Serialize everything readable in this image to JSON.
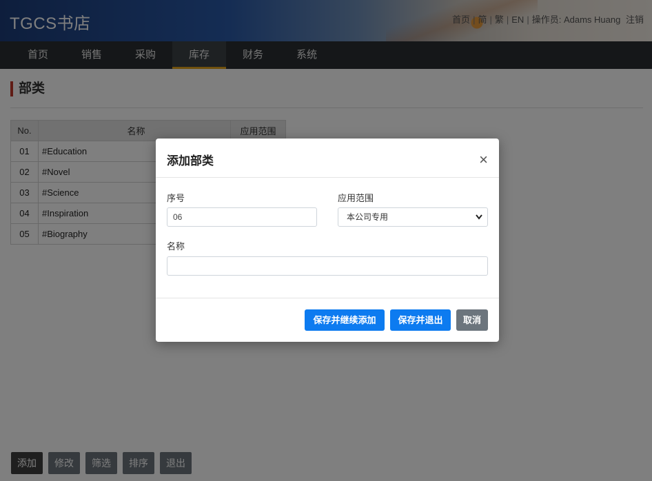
{
  "header": {
    "brand": "TGCS书店",
    "links": [
      "首页",
      "简",
      "繁",
      "EN"
    ],
    "operator_label": "操作员:",
    "operator_name": "Adams Huang",
    "logout": "注销"
  },
  "nav": {
    "items": [
      "首页",
      "销售",
      "采购",
      "库存",
      "财务",
      "系统"
    ],
    "active": "库存"
  },
  "page": {
    "title": "部类"
  },
  "table": {
    "headers": [
      "No.",
      "名称",
      "应用范围"
    ],
    "rows": [
      {
        "no": "01",
        "name": "#Education"
      },
      {
        "no": "02",
        "name": "#Novel"
      },
      {
        "no": "03",
        "name": "#Science"
      },
      {
        "no": "04",
        "name": "#Inspiration"
      },
      {
        "no": "05",
        "name": "#Biography"
      }
    ]
  },
  "bottom_buttons": [
    "添加",
    "修改",
    "筛选",
    "排序",
    "退出"
  ],
  "modal": {
    "title": "添加部类",
    "close": "×",
    "seq_label": "序号",
    "seq_value": "06",
    "scope_label": "应用范围",
    "scope_selected": "本公司专用",
    "name_label": "名称",
    "name_value": "",
    "btn_save_continue": "保存并继续添加",
    "btn_save_exit": "保存并退出",
    "btn_cancel": "取消"
  },
  "colors": {
    "primary": "#0d7bf0",
    "secondary": "#6c757d",
    "nav_bg": "#2b2f33",
    "nav_active_underline": "#e0a31b",
    "title_accent": "#c0392b"
  }
}
